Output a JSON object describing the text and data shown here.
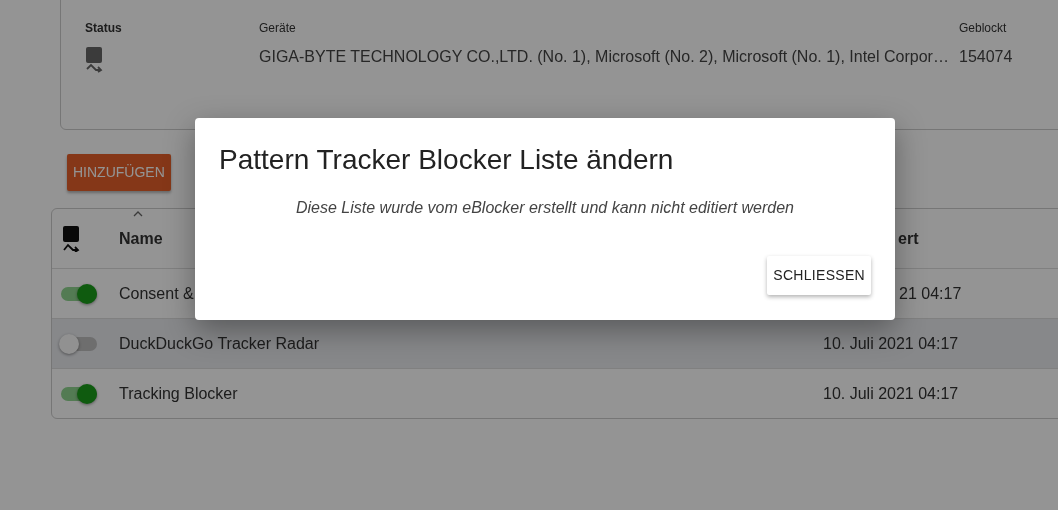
{
  "device_card": {
    "columns": [
      "Status",
      "Geräte",
      "Geblockt"
    ],
    "row": {
      "devices": "GIGA-BYTE TECHNOLOGY CO.,LTD. (No. 1), Microsoft (No. 2), Microsoft (No. 1), Intel Corpor…",
      "blocked": "154074"
    }
  },
  "add_button": "HINZUFÜGEN",
  "table": {
    "columns": [
      "Name",
      "ert"
    ],
    "rows": [
      {
        "enabled": true,
        "selected": false,
        "name": "Consent &",
        "date": "21 04:17"
      },
      {
        "enabled": false,
        "selected": true,
        "name": "DuckDuckGo Tracker Radar",
        "date": "10. Juli 2021 04:17"
      },
      {
        "enabled": true,
        "selected": false,
        "name": "Tracking Blocker",
        "date": "10. Juli 2021 04:17"
      }
    ]
  },
  "dialog": {
    "title": "Pattern Tracker Blocker Liste ändern",
    "message": "Diese Liste wurde vom eBlocker erstellt und kann nicht editiert werden",
    "button": "SCHLIESSEN"
  }
}
